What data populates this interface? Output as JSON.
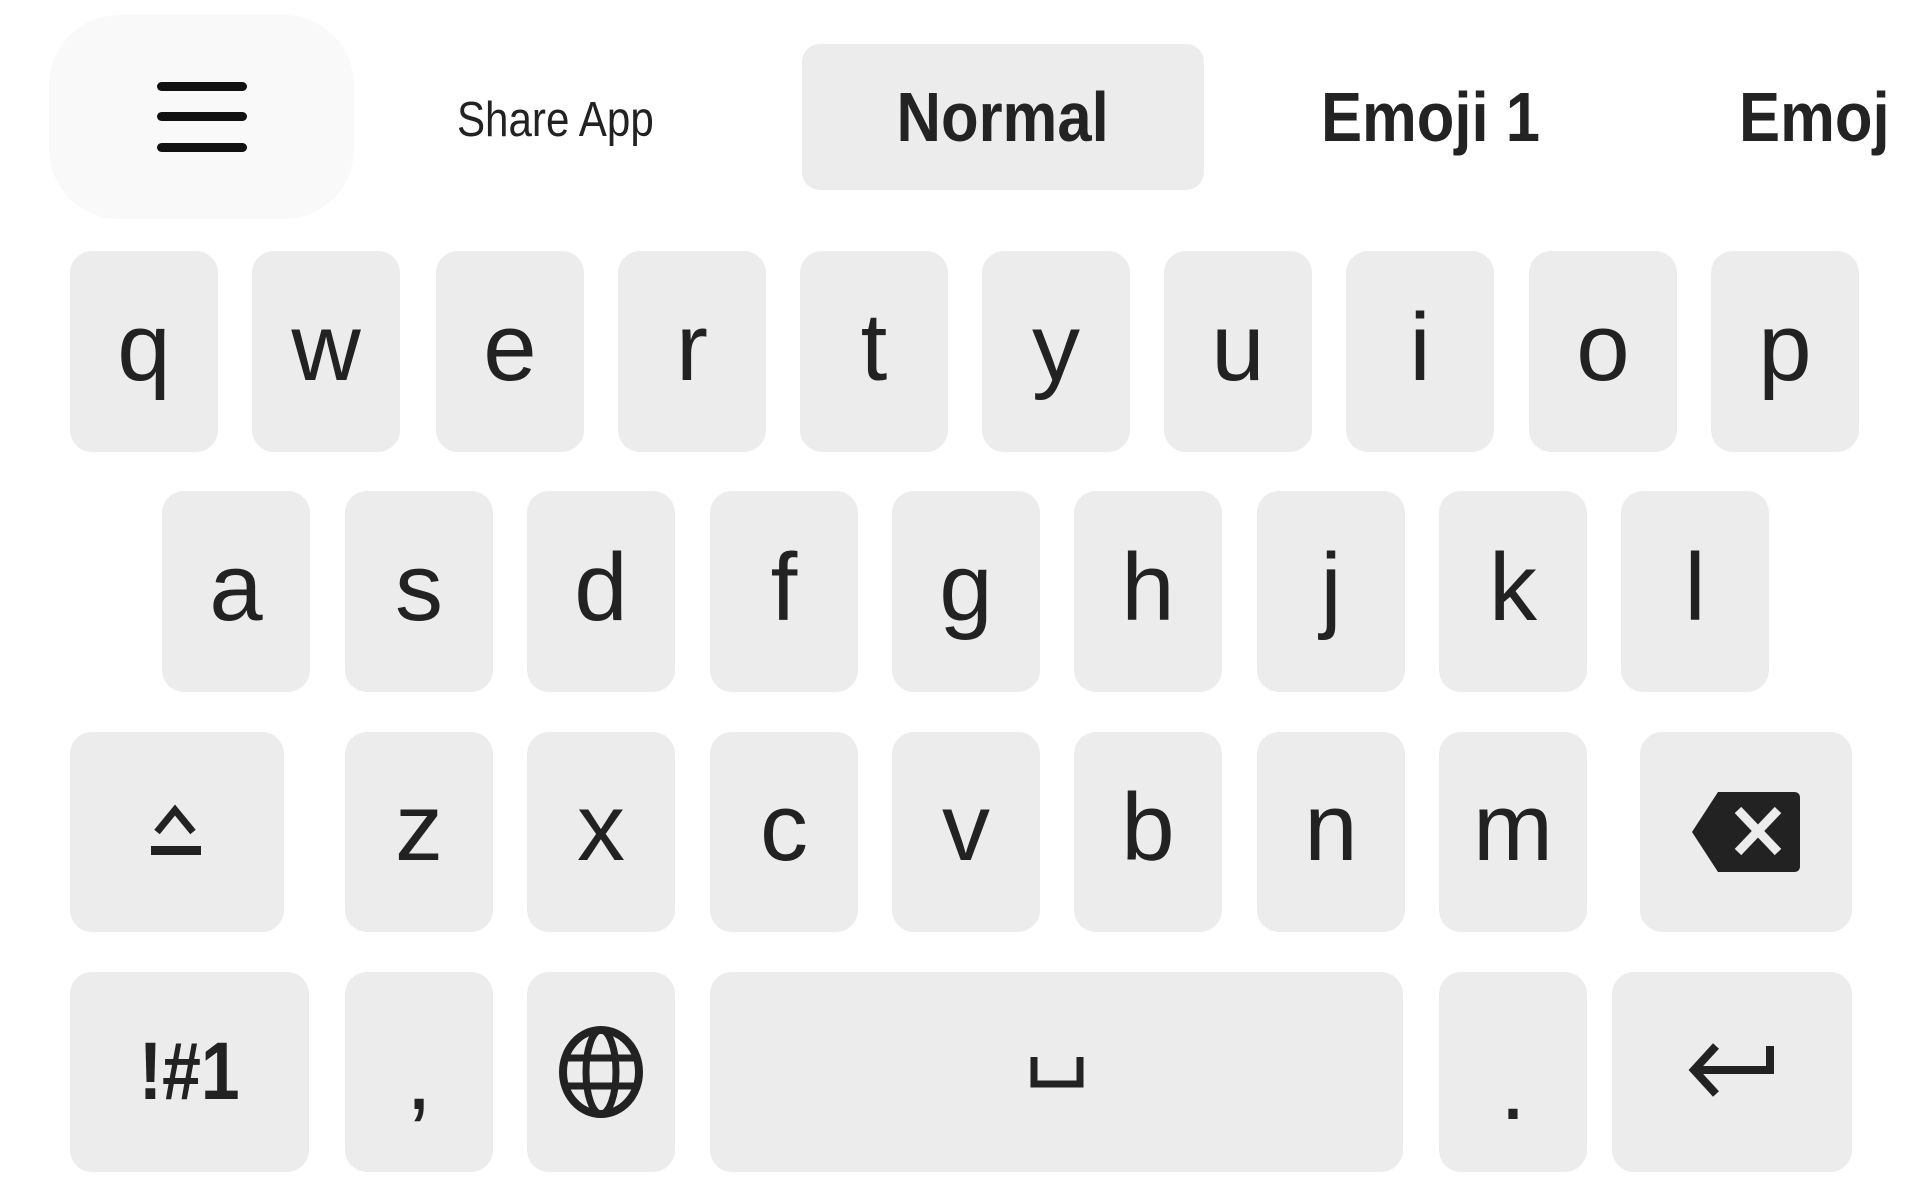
{
  "toolbar": {
    "menu_icon": "hamburger-menu-icon",
    "share_label": "Share App",
    "tabs": [
      {
        "label": "Normal",
        "active": true
      },
      {
        "label": "Emoji 1",
        "active": false
      },
      {
        "label": "Emoj",
        "active": false
      }
    ]
  },
  "keyboard": {
    "row1": [
      "q",
      "w",
      "e",
      "r",
      "t",
      "y",
      "u",
      "i",
      "o",
      "p"
    ],
    "row2": [
      "a",
      "s",
      "d",
      "f",
      "g",
      "h",
      "j",
      "k",
      "l"
    ],
    "row3": {
      "shift_icon": "shift-icon",
      "letters": [
        "z",
        "x",
        "c",
        "v",
        "b",
        "n",
        "m"
      ],
      "backspace_icon": "backspace-icon"
    },
    "row4": {
      "symbols_label": "!#1",
      "comma": ",",
      "globe_icon": "globe-icon",
      "space_icon": "space-bar-icon",
      "period": ".",
      "enter_icon": "enter-icon"
    }
  },
  "colors": {
    "background": "#ffffff",
    "key_background": "#ececec",
    "menu_button_background": "#f9f9f9",
    "text": "#222222"
  }
}
